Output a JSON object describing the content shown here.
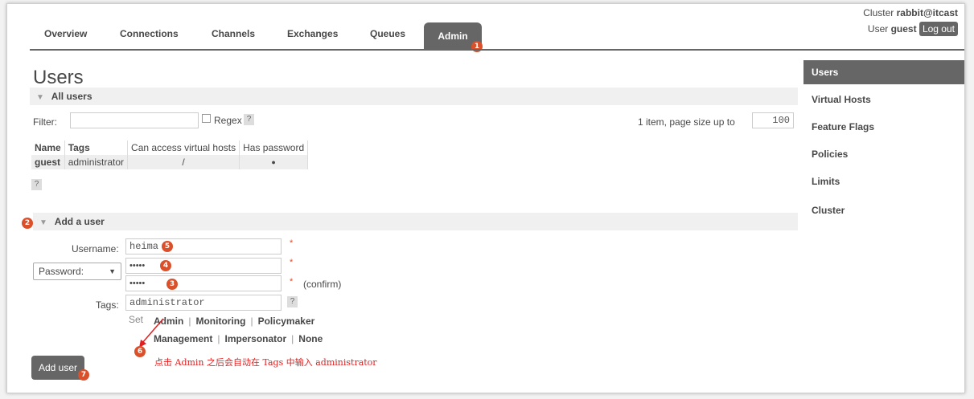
{
  "header": {
    "cluster_label": "Cluster",
    "cluster_name": "rabbit@itcast",
    "user_label": "User",
    "user_name": "guest",
    "logout_label": "Log out"
  },
  "tabs": [
    {
      "label": "Overview"
    },
    {
      "label": "Connections"
    },
    {
      "label": "Channels"
    },
    {
      "label": "Exchanges"
    },
    {
      "label": "Queues"
    },
    {
      "label": "Admin",
      "active": true
    }
  ],
  "sidebar": {
    "items": [
      {
        "label": "Users",
        "active": true
      },
      {
        "label": "Virtual Hosts"
      },
      {
        "label": "Feature Flags"
      },
      {
        "label": "Policies"
      },
      {
        "label": "Limits"
      },
      {
        "label": "Cluster"
      }
    ]
  },
  "page_title": "Users",
  "all_users": {
    "section_label": "All users",
    "filter_label": "Filter:",
    "filter_value": "",
    "regex_label": "Regex",
    "help": "?",
    "page_size_text": "1 item, page size up to",
    "page_size_value": "100",
    "columns": [
      "Name",
      "Tags",
      "Can access virtual hosts",
      "Has password"
    ],
    "rows": [
      {
        "name": "guest",
        "tags": "administrator",
        "vhosts": "/",
        "has_password": "●"
      }
    ]
  },
  "add_user": {
    "section_label": "Add a user",
    "username_label": "Username:",
    "username_value": "heima",
    "password_select": "Password:",
    "password_mask": "•••••",
    "confirm_mask": "•••••",
    "required_mark": "*",
    "confirm_label": "(confirm)",
    "tags_label": "Tags:",
    "tags_value": "administrator",
    "set_label": "Set",
    "tag_options_row1": [
      "Admin",
      "Monitoring",
      "Policymaker"
    ],
    "tag_options_row2": [
      "Management",
      "Impersonator",
      "None"
    ],
    "submit_label": "Add user"
  },
  "annotations": {
    "badges": [
      "1",
      "2",
      "3",
      "4",
      "5",
      "6",
      "7"
    ],
    "note": "点击 Admin 之后会自动在 Tags 中输入 administrator",
    "color": "#d9502a"
  }
}
